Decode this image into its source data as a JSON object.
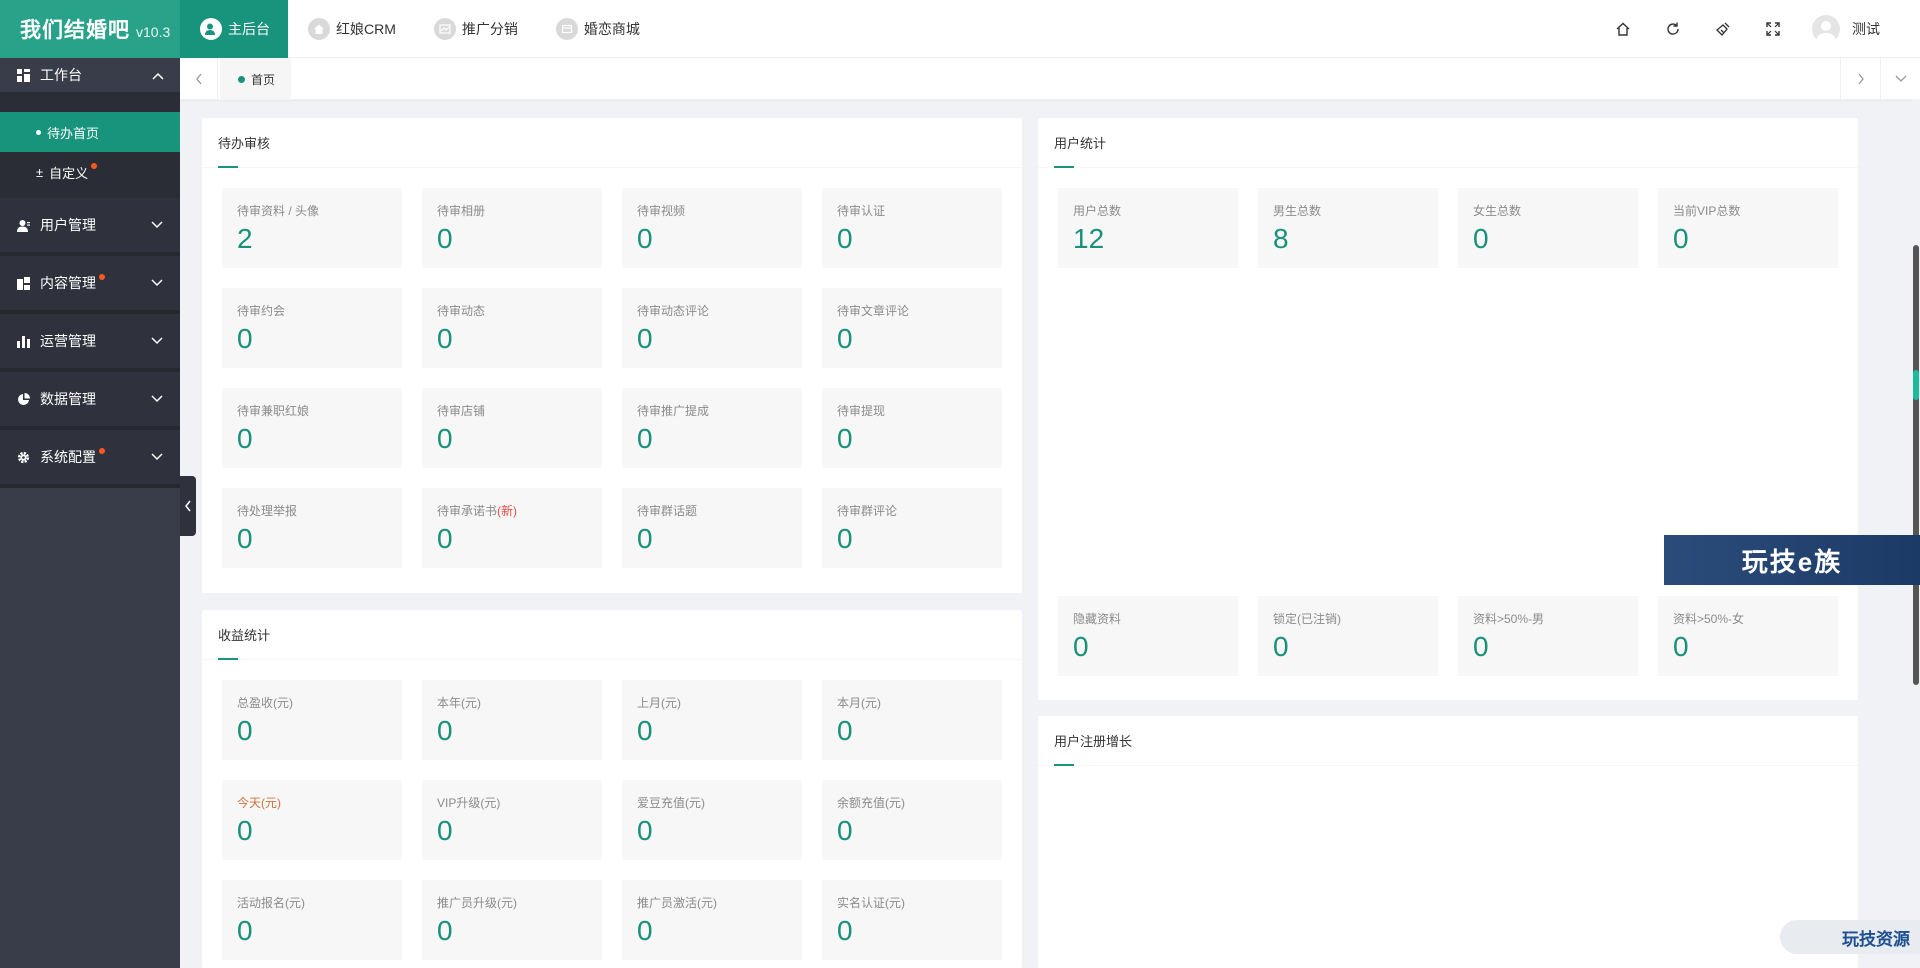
{
  "app": {
    "name": "我们结婚吧",
    "version": "v10.3"
  },
  "colors": {
    "accent": "#19947c",
    "sidebar": "#393d49",
    "value": "#18907a",
    "badge_dot": "#ff5722"
  },
  "topnav": [
    {
      "label": "主后台",
      "icon": "user-circle-icon",
      "active": true
    },
    {
      "label": "红娘CRM",
      "icon": "home-circle-icon"
    },
    {
      "label": "推广分销",
      "icon": "chart-circle-icon"
    },
    {
      "label": "婚恋商城",
      "icon": "shop-circle-icon"
    }
  ],
  "user": {
    "name": "测试"
  },
  "tabs": {
    "current": "首页"
  },
  "sidebar": {
    "workbench": {
      "label": "工作台",
      "items": [
        {
          "label": "待办首页"
        },
        {
          "label": "自定义"
        }
      ]
    },
    "groups": [
      {
        "label": "用户管理",
        "icon": "user-icon"
      },
      {
        "label": "内容管理",
        "icon": "content-icon"
      },
      {
        "label": "运营管理",
        "icon": "bar-chart-icon"
      },
      {
        "label": "数据管理",
        "icon": "pie-chart-icon"
      },
      {
        "label": "系统配置",
        "icon": "gear-icon"
      }
    ]
  },
  "pending": {
    "title": "待办审核",
    "items": [
      {
        "label": "待审资料 / 头像",
        "value": "2"
      },
      {
        "label": "待审相册",
        "value": "0"
      },
      {
        "label": "待审视频",
        "value": "0"
      },
      {
        "label": "待审认证",
        "value": "0"
      },
      {
        "label": "待审约会",
        "value": "0"
      },
      {
        "label": "待审动态",
        "value": "0"
      },
      {
        "label": "待审动态评论",
        "value": "0"
      },
      {
        "label": "待审文章评论",
        "value": "0"
      },
      {
        "label": "待审兼职红娘",
        "value": "0"
      },
      {
        "label": "待审店铺",
        "value": "0"
      },
      {
        "label": "待审推广提成",
        "value": "0"
      },
      {
        "label": "待审提现",
        "value": "0"
      },
      {
        "label": "待处理举报",
        "value": "0"
      },
      {
        "label": "待审承诺书",
        "new": "(新)",
        "value": "0"
      },
      {
        "label": "待审群话题",
        "value": "0"
      },
      {
        "label": "待审群评论",
        "value": "0"
      }
    ]
  },
  "income": {
    "title": "收益统计",
    "items": [
      {
        "label": "总盈收(元)",
        "value": "0"
      },
      {
        "label": "本年(元)",
        "value": "0"
      },
      {
        "label": "上月(元)",
        "value": "0"
      },
      {
        "label": "本月(元)",
        "value": "0"
      },
      {
        "label": "今天(元)",
        "value": "0"
      },
      {
        "label": "VIP升级(元)",
        "value": "0"
      },
      {
        "label": "爱豆充值(元)",
        "value": "0"
      },
      {
        "label": "余额充值(元)",
        "value": "0"
      },
      {
        "label": "活动报名(元)",
        "value": "0"
      },
      {
        "label": "推广员升级(元)",
        "value": "0"
      },
      {
        "label": "推广员激活(元)",
        "value": "0"
      },
      {
        "label": "实名认证(元)",
        "value": "0"
      }
    ]
  },
  "user_stats": {
    "title": "用户统计",
    "top": [
      {
        "label": "用户总数",
        "value": "12"
      },
      {
        "label": "男生总数",
        "value": "8"
      },
      {
        "label": "女生总数",
        "value": "0"
      },
      {
        "label": "当前VIP总数",
        "value": "0"
      }
    ],
    "bottom": [
      {
        "label": "隐藏资料",
        "value": "0"
      },
      {
        "label": "锁定(已注销)",
        "value": "0"
      },
      {
        "label": "资料>50%-男",
        "value": "0"
      },
      {
        "label": "资料>50%-女",
        "value": "0"
      }
    ]
  },
  "register": {
    "title": "用户注册增长"
  },
  "watermarks": {
    "banner": "玩技e族",
    "badge": "玩技资源"
  }
}
